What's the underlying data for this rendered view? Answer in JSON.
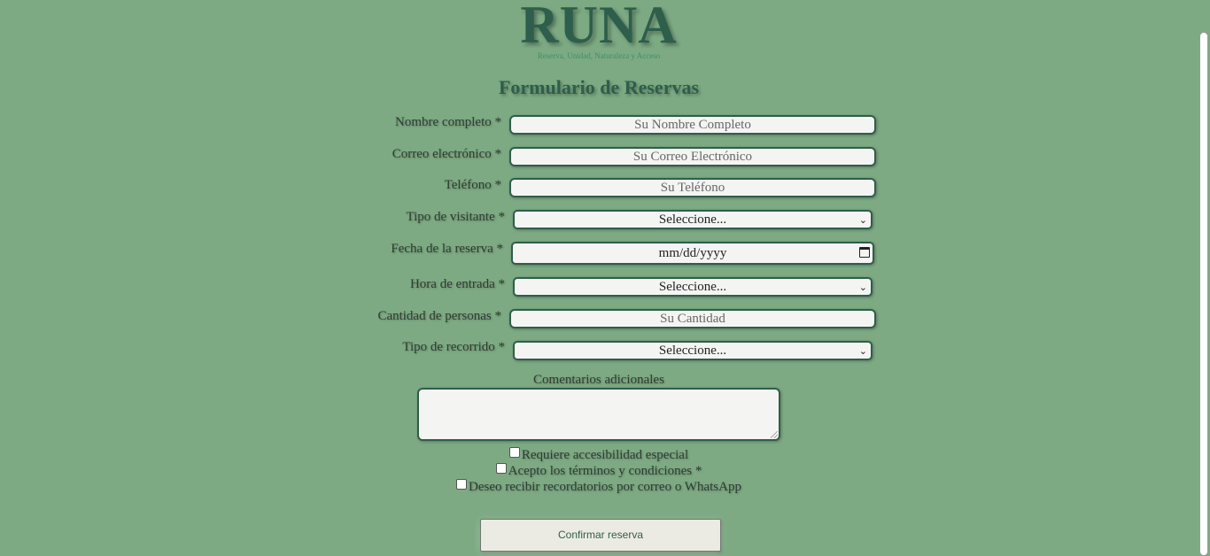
{
  "brand": {
    "logo": "RUNA",
    "tagline": "Reserva, Unidad, Naturaleza y Acceso"
  },
  "form": {
    "title": "Formulario de Reservas",
    "fields": {
      "name": {
        "label": "Nombre completo *",
        "placeholder": "Su Nombre Completo"
      },
      "email": {
        "label": "Correo electrónico *",
        "placeholder": "Su Correo Electrónico"
      },
      "phone": {
        "label": "Teléfono *",
        "placeholder": "Su Teléfono"
      },
      "visitor_type": {
        "label": "Tipo de visitante *",
        "value": "Seleccione..."
      },
      "date": {
        "label": "Fecha de la reserva *",
        "value": "mm/dd/yyyy"
      },
      "entry_time": {
        "label": "Hora de entrada *",
        "value": "Seleccione..."
      },
      "people": {
        "label": "Cantidad de personas *",
        "placeholder": "Su Cantidad"
      },
      "tour_type": {
        "label": "Tipo de recorrido *",
        "value": "Seleccione..."
      },
      "comments": {
        "label": "Comentarios adicionales",
        "value": ""
      }
    },
    "checkboxes": {
      "accessibility": "Requiere accesibilidad especial",
      "terms": "Acepto los términos y condiciones *",
      "reminders": "Deseo recibir recordatorios por correo o WhatsApp"
    },
    "submit_label": "Confirmar reserva"
  },
  "icons": {
    "select": "chevron-down-icon",
    "date": "calendar-icon"
  },
  "colors": {
    "background": "#7daa83",
    "brand": "#2e5e4c",
    "field_bg": "#f4f5f3",
    "button_bg": "#ecebe3"
  }
}
